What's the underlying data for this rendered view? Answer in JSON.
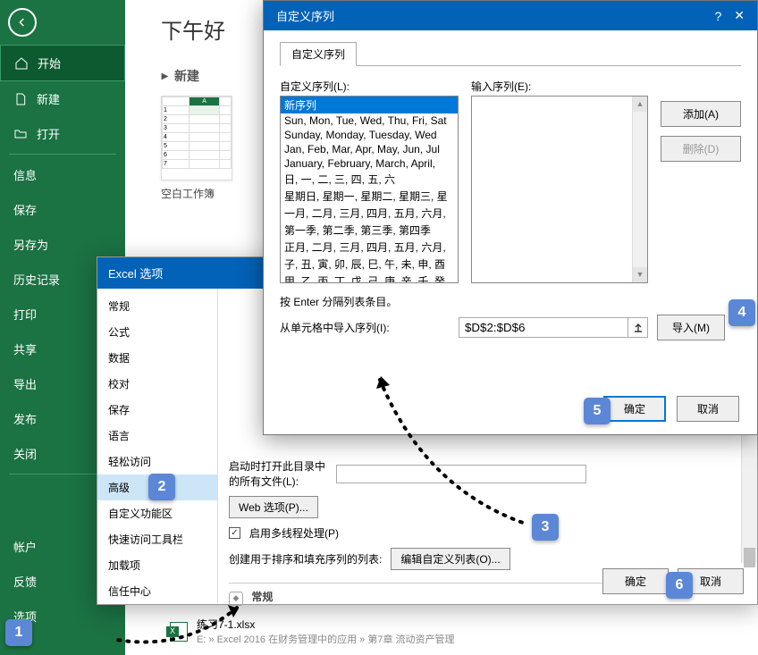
{
  "sidebar": {
    "start": "开始",
    "new": "新建",
    "open": "打开",
    "info": "信息",
    "save": "保存",
    "saveas": "另存为",
    "history": "历史记录",
    "print": "打印",
    "share": "共享",
    "export": "导出",
    "publish": "发布",
    "close": "关闭",
    "account": "帐户",
    "feedback": "反馈",
    "options": "选项"
  },
  "main": {
    "greeting": "下午好",
    "new_section": "新建",
    "col_a": "A",
    "blank_workbook": "空白工作簿"
  },
  "file": {
    "name": "练习7-1.xlsx",
    "path": "E: » Excel 2016 在财务管理中的应用 » 第7章 流动资产管理"
  },
  "options_dialog": {
    "title": "Excel 选项",
    "sidebar": [
      "常规",
      "公式",
      "数据",
      "校对",
      "保存",
      "语言",
      "轻松访问",
      "高级",
      "自定义功能区",
      "快速访问工具栏",
      "加载项",
      "信任中心"
    ],
    "content": {
      "common_btn": "常",
      "dir_label": "启动时打开此目录中的所有文件(L):",
      "web_btn": "Web 选项(P)...",
      "multithread": "启用多线程处理(P)",
      "customlist_label": "创建用于排序和填充序列的列表:",
      "customlist_btn": "编辑自定义列表(O)...",
      "section_hdr": "常规"
    },
    "ok": "确定",
    "cancel": "取消"
  },
  "custom_dialog": {
    "title": "自定义序列",
    "help": "?",
    "close": "✕",
    "tab": "自定义序列",
    "list_label": "自定义序列(L):",
    "entries_label": "输入序列(E):",
    "lists": [
      "新序列",
      "Sun, Mon, Tue, Wed, Thu, Fri, Sat",
      "Sunday, Monday, Tuesday, Wed",
      "Jan, Feb, Mar, Apr, May, Jun, Jul",
      "January, February, March, April,",
      "日, 一, 二, 三, 四, 五, 六",
      "星期日, 星期一, 星期二, 星期三, 星",
      "一月, 二月, 三月, 四月, 五月, 六月,",
      "第一季, 第二季, 第三季, 第四季",
      "正月, 二月, 三月, 四月, 五月, 六月,",
      "子, 丑, 寅, 卯, 辰, 巳, 午, 未, 申, 酉",
      "甲, 乙, 丙, 丁, 戊, 己, 庚, 辛, 壬, 癸"
    ],
    "add_btn": "添加(A)",
    "delete_btn": "删除(D)",
    "press_enter": "按 Enter 分隔列表条目。",
    "import_label": "从单元格中导入序列(I):",
    "import_range": "$D$2:$D$6",
    "import_btn": "导入(M)",
    "ok": "确定",
    "cancel": "取消"
  },
  "callouts": {
    "1": "1",
    "2": "2",
    "3": "3",
    "4": "4",
    "5": "5",
    "6": "6"
  }
}
